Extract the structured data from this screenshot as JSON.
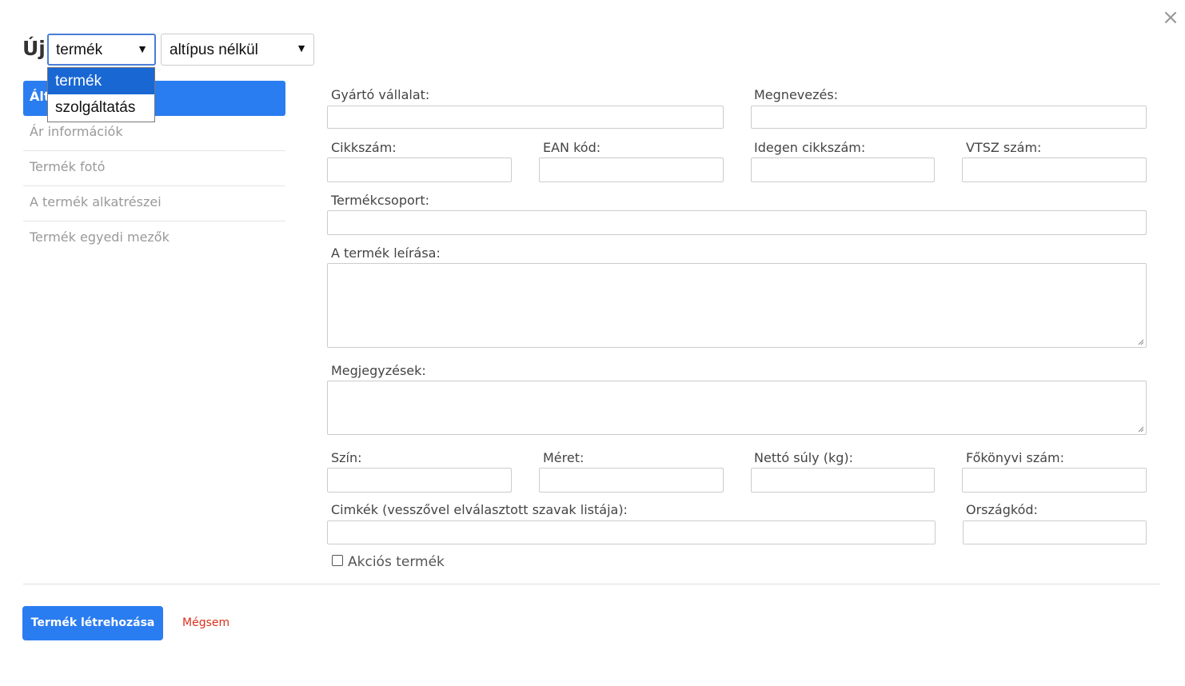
{
  "header": {
    "title": "Új",
    "type_select": {
      "value": "termék",
      "options": [
        "termék",
        "szolgáltatás"
      ],
      "highlighted": "termék"
    },
    "subtype_select": {
      "value": "altípus nélkül"
    },
    "close_icon": "×"
  },
  "sidebar": {
    "items": [
      {
        "label": "Ált",
        "active": true
      },
      {
        "label": "Ár információk"
      },
      {
        "label": "Termék fotó"
      },
      {
        "label": "A termék alkatrészei"
      },
      {
        "label": "Termék egyedi mezők"
      }
    ]
  },
  "form": {
    "manufacturer": {
      "label": "Gyártó vállalat:",
      "value": ""
    },
    "name": {
      "label": "Megnevezés:",
      "value": ""
    },
    "sku": {
      "label": "Cikkszám:",
      "value": ""
    },
    "ean": {
      "label": "EAN kód:",
      "value": ""
    },
    "foreign_sku": {
      "label": "Idegen cikkszám:",
      "value": ""
    },
    "vtsz": {
      "label": "VTSZ szám:",
      "value": ""
    },
    "group": {
      "label": "Termékcsoport:",
      "value": ""
    },
    "description": {
      "label": "A termék leírása:",
      "value": ""
    },
    "notes": {
      "label": "Megjegyzések:",
      "value": ""
    },
    "color": {
      "label": "Szín:",
      "value": ""
    },
    "size": {
      "label": "Méret:",
      "value": ""
    },
    "net_weight": {
      "label": "Nettó súly (kg):",
      "value": ""
    },
    "ledger": {
      "label": "Főkönyvi szám:",
      "value": ""
    },
    "tags": {
      "label": "Cimkék (vesszővel elválasztott szavak listája):",
      "value": ""
    },
    "country": {
      "label": "Országkód:",
      "value": ""
    },
    "promo": {
      "label": "Akciós termék",
      "checked": false
    }
  },
  "footer": {
    "create_label": "Termék létrehozása",
    "cancel_label": "Mégsem"
  },
  "colors": {
    "primary": "#2a7df0",
    "cancel": "#d9301d",
    "highlight": "#1967d2"
  }
}
